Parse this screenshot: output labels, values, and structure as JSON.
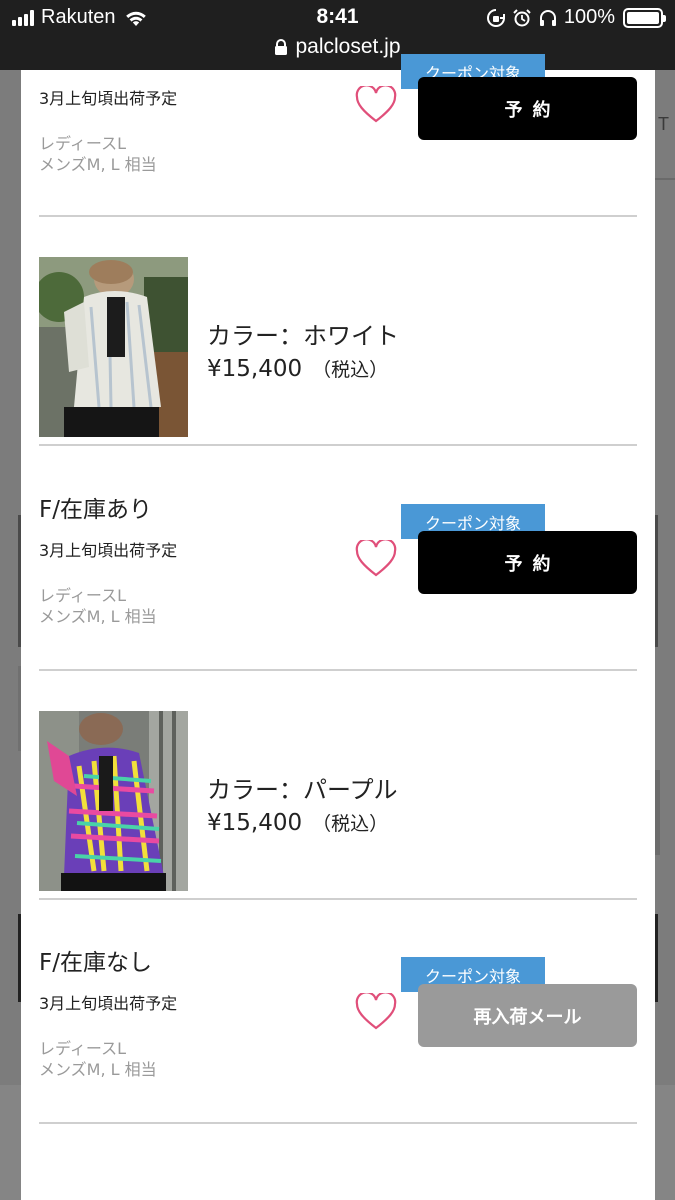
{
  "status_bar": {
    "carrier": "Rakuten",
    "time": "8:41",
    "battery": "100%",
    "url": "palcloset.jp"
  },
  "colors": {
    "coupon": "#4a98d6",
    "reserve_button": "#000000",
    "restock_button": "#9a9a9a",
    "heart": "#e04f7a"
  },
  "variants": [
    {
      "coupon": "クーポン対象",
      "ship": "3月上旬頃出荷予定",
      "note1": "レディースL",
      "note2": "メンズM, L 相当",
      "button": "予約",
      "favorite_icon": "heart-outline-icon"
    },
    {
      "color": "カラー：ホワイト",
      "price": "¥15,400",
      "tax": "（税込）",
      "size_stock": "F/在庫あり",
      "coupon": "クーポン対象",
      "ship": "3月上旬頃出荷予定",
      "note1": "レディースL",
      "note2": "メンズM, L 相当",
      "button": "予約",
      "favorite_icon": "heart-outline-icon"
    },
    {
      "color": "カラー：パープル",
      "price": "¥15,400",
      "tax": "（税込）",
      "size_stock": "F/在庫なし",
      "coupon": "クーポン対象",
      "ship": "3月上旬頃出荷予定",
      "note1": "レディースL",
      "note2": "メンズM, L 相当",
      "button": "再入荷メール",
      "favorite_icon": "heart-outline-icon"
    }
  ],
  "background_page": {
    "fragment_right": "T"
  }
}
